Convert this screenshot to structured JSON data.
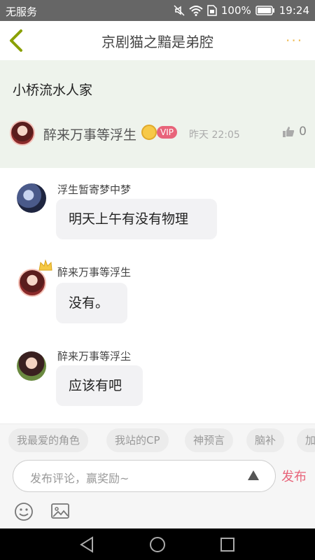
{
  "status_bar": {
    "carrier": "无服务",
    "battery": "100%",
    "time": "19:24"
  },
  "nav": {
    "title": "京剧猫之黯是弟腔",
    "more": "···"
  },
  "topic": {
    "title": "小桥流水人家",
    "author": "醉来万事等浮生",
    "vip": "VIP",
    "time": "昨天 22:05",
    "likes": "0"
  },
  "messages": [
    {
      "name": "浮生暂寄梦中梦",
      "text": "明天上午有没有物理"
    },
    {
      "name": "醉来万事等浮生",
      "text": "没有。"
    },
    {
      "name": "醉来万事等浮尘",
      "text": "应该有吧"
    }
  ],
  "tags": [
    "我最爱的角色",
    "我站的CP",
    "神预言",
    "脑补",
    "加"
  ],
  "composer": {
    "placeholder": "发布评论，赢奖励~",
    "publish": "发布"
  },
  "colors": {
    "accent": "#e8647a",
    "topic_bg": "#eef3ec",
    "bubble_bg": "#f2f2f4",
    "back_arrow": "#8aa000"
  }
}
